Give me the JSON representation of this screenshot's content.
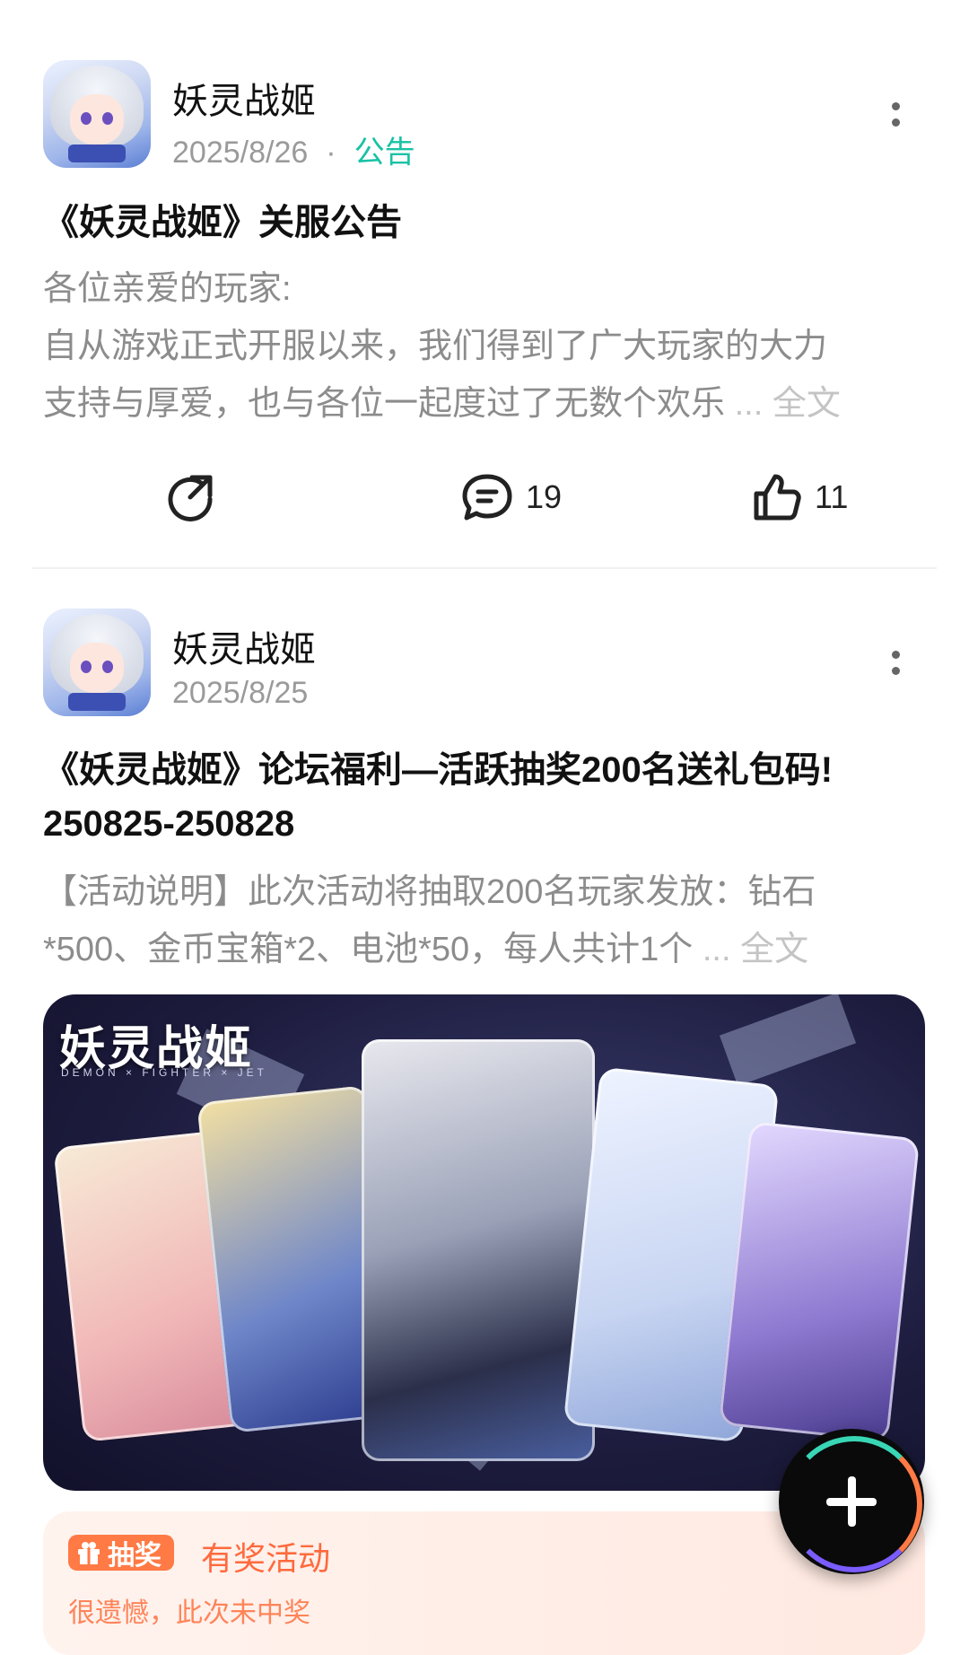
{
  "posts": [
    {
      "author": "妖灵战姬",
      "date": "2025/8/26",
      "separator": "·",
      "tag": "公告",
      "title": "《妖灵战姬》关服公告",
      "body_lines": [
        "各位亲爱的玩家:",
        "自从游戏正式开服以来，我们得到了广大玩家的大力",
        "支持与厚爱，也与各位一起度过了无数个欢乐"
      ],
      "ellipsis": "...",
      "fulltext_label": "全文",
      "comments": "19",
      "likes": "11"
    },
    {
      "author": "妖灵战姬",
      "date": "2025/8/25",
      "title_lines": [
        "《妖灵战姬》论坛福利—活跃抽奖200名送礼包码!",
        "250825-250828"
      ],
      "body_lines": [
        "【活动说明】此次活动将抽取200名玩家发放：钻石",
        "*500、金币宝箱*2、电池*50，每人共计1个"
      ],
      "ellipsis": "...",
      "fulltext_label": "全文",
      "banner": {
        "logo_text": "妖灵战姬",
        "logo_subtext": "DEMON × FIGHTER × JET"
      },
      "promo": {
        "badge": "抽奖",
        "title": "有奖活动",
        "result": "很遗憾，此次未中奖"
      }
    }
  ],
  "icons": {
    "share": "share-icon",
    "comment": "comment-icon",
    "like": "like-icon",
    "more": "more-vertical-icon",
    "add": "plus-icon",
    "gift": "gift-icon"
  },
  "colors": {
    "tag": "#19c2a5",
    "promo_accent": "#ff7a45",
    "muted_text": "#8c8c8c"
  }
}
